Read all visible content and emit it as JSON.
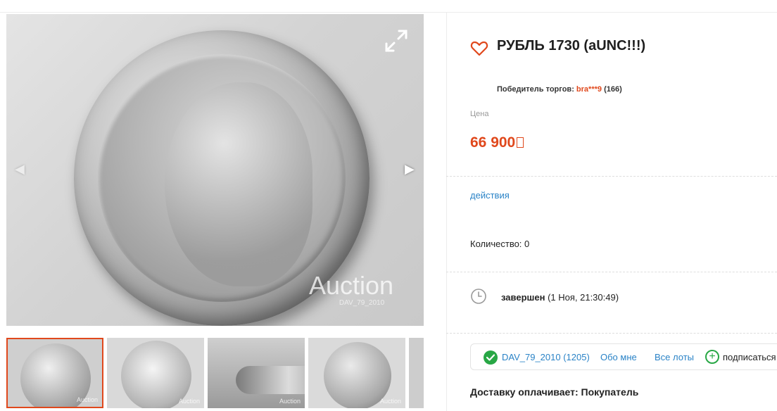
{
  "lot": {
    "title": "РУБЛЬ 1730 (aUNC!!!)",
    "winner_label": "Победитель торгов:",
    "winner_user": "bra***9",
    "winner_rating": "(166)",
    "price_label": "Цена",
    "price": "66 900",
    "actions_link": "действия",
    "quantity": "Количество: 0",
    "status_bold": "завершен",
    "status_time": "(1 Ноя, 21:30:49)",
    "delivery": "Доставку оплачивает: Покупатель"
  },
  "seller": {
    "name": "DAV_79_2010 (1205)",
    "about_link": "Обо мне",
    "lots_link": "Все лоты",
    "subscribe": "подписаться"
  },
  "gallery": {
    "watermark": "Auction",
    "watermark_sub": "DAV_79_2010",
    "thumb_watermark": "Auction",
    "thumbnails": [
      "coin-obverse",
      "coin-reverse-eagle",
      "coin-edge",
      "coin-obverse-angle"
    ]
  },
  "colors": {
    "accent": "#e0481c",
    "link": "#2a83c7",
    "verified": "#28a745"
  },
  "icons": [
    "heart-icon",
    "expand-icon",
    "arrow-left-icon",
    "arrow-right-icon",
    "clock-icon",
    "check-icon",
    "plus-icon"
  ]
}
